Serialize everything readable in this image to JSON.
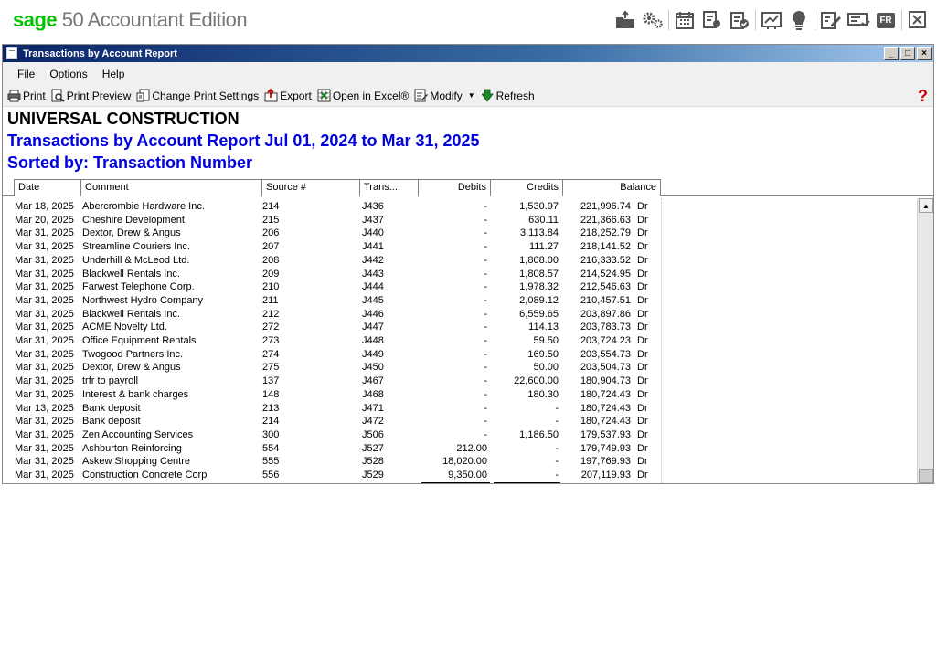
{
  "brand": {
    "sage": "sage",
    "rest": " 50 Accountant Edition"
  },
  "app_tools": [
    "folder-arrow-icon",
    "gears-icon",
    "calendar-icon",
    "gear-document-icon",
    "clipboard-check-icon",
    "chart-icon",
    "lightbulb-icon",
    "pen-document-icon",
    "check-icon",
    "FR",
    "exit-icon"
  ],
  "window": {
    "title": "Transactions by Account Report",
    "minimize": "_",
    "maximize": "□",
    "close": "×"
  },
  "menu": [
    "File",
    "Options",
    "Help"
  ],
  "toolbar": {
    "print": "Print",
    "print_preview": "Print Preview",
    "change_print_settings": "Change Print Settings",
    "export": "Export",
    "open_in_excel": "Open in Excel®",
    "modify": "Modify",
    "refresh": "Refresh",
    "help": "?"
  },
  "report": {
    "company": "UNIVERSAL CONSTRUCTION",
    "title": "Transactions by Account Report Jul 01, 2024 to Mar 31, 2025",
    "sorted_by": "Sorted by: Transaction Number"
  },
  "columns": [
    "Date",
    "Comment",
    "Source #",
    "Trans....",
    "Debits",
    "Credits",
    "Balance"
  ],
  "rows": [
    {
      "date": "Mar 18, 2025",
      "comment": "Abercrombie Hardware Inc.",
      "source": "214",
      "trans": "J436",
      "debits": "-",
      "credits": "1,530.97",
      "balance": "221,996.74",
      "drcr": "Dr"
    },
    {
      "date": "Mar 20, 2025",
      "comment": "Cheshire Development",
      "source": "215",
      "trans": "J437",
      "debits": "-",
      "credits": "630.11",
      "balance": "221,366.63",
      "drcr": "Dr"
    },
    {
      "date": "Mar 31, 2025",
      "comment": "Dextor, Drew & Angus",
      "source": "206",
      "trans": "J440",
      "debits": "-",
      "credits": "3,113.84",
      "balance": "218,252.79",
      "drcr": "Dr"
    },
    {
      "date": "Mar 31, 2025",
      "comment": "Streamline Couriers Inc.",
      "source": "207",
      "trans": "J441",
      "debits": "-",
      "credits": "111.27",
      "balance": "218,141.52",
      "drcr": "Dr"
    },
    {
      "date": "Mar 31, 2025",
      "comment": "Underhill & McLeod Ltd.",
      "source": "208",
      "trans": "J442",
      "debits": "-",
      "credits": "1,808.00",
      "balance": "216,333.52",
      "drcr": "Dr"
    },
    {
      "date": "Mar 31, 2025",
      "comment": "Blackwell Rentals Inc.",
      "source": "209",
      "trans": "J443",
      "debits": "-",
      "credits": "1,808.57",
      "balance": "214,524.95",
      "drcr": "Dr"
    },
    {
      "date": "Mar 31, 2025",
      "comment": "Farwest Telephone Corp.",
      "source": "210",
      "trans": "J444",
      "debits": "-",
      "credits": "1,978.32",
      "balance": "212,546.63",
      "drcr": "Dr"
    },
    {
      "date": "Mar 31, 2025",
      "comment": "Northwest Hydro Company",
      "source": "211",
      "trans": "J445",
      "debits": "-",
      "credits": "2,089.12",
      "balance": "210,457.51",
      "drcr": "Dr"
    },
    {
      "date": "Mar 31, 2025",
      "comment": "Blackwell Rentals Inc.",
      "source": "212",
      "trans": "J446",
      "debits": "-",
      "credits": "6,559.65",
      "balance": "203,897.86",
      "drcr": "Dr"
    },
    {
      "date": "Mar 31, 2025",
      "comment": "ACME Novelty Ltd.",
      "source": "272",
      "trans": "J447",
      "debits": "-",
      "credits": "114.13",
      "balance": "203,783.73",
      "drcr": "Dr"
    },
    {
      "date": "Mar 31, 2025",
      "comment": "Office Equipment Rentals",
      "source": "273",
      "trans": "J448",
      "debits": "-",
      "credits": "59.50",
      "balance": "203,724.23",
      "drcr": "Dr"
    },
    {
      "date": "Mar 31, 2025",
      "comment": "Twogood Partners Inc.",
      "source": "274",
      "trans": "J449",
      "debits": "-",
      "credits": "169.50",
      "balance": "203,554.73",
      "drcr": "Dr"
    },
    {
      "date": "Mar 31, 2025",
      "comment": "Dextor, Drew & Angus",
      "source": "275",
      "trans": "J450",
      "debits": "-",
      "credits": "50.00",
      "balance": "203,504.73",
      "drcr": "Dr"
    },
    {
      "date": "Mar 31, 2025",
      "comment": "trfr to payroll",
      "source": "137",
      "trans": "J467",
      "debits": "-",
      "credits": "22,600.00",
      "balance": "180,904.73",
      "drcr": "Dr"
    },
    {
      "date": "Mar 31, 2025",
      "comment": "Interest & bank charges",
      "source": "148",
      "trans": "J468",
      "debits": "-",
      "credits": "180.30",
      "balance": "180,724.43",
      "drcr": "Dr"
    },
    {
      "date": "Mar 13, 2025",
      "comment": "Bank deposit",
      "source": "213",
      "trans": "J471",
      "debits": "-",
      "credits": "-",
      "balance": "180,724.43",
      "drcr": "Dr"
    },
    {
      "date": "Mar 31, 2025",
      "comment": "Bank deposit",
      "source": "214",
      "trans": "J472",
      "debits": "-",
      "credits": "-",
      "balance": "180,724.43",
      "drcr": "Dr"
    },
    {
      "date": "Mar 31, 2025",
      "comment": "Zen Accounting Services",
      "source": "300",
      "trans": "J506",
      "debits": "-",
      "credits": "1,186.50",
      "balance": "179,537.93",
      "drcr": "Dr"
    },
    {
      "date": "Mar 31, 2025",
      "comment": "Ashburton Reinforcing",
      "source": "554",
      "trans": "J527",
      "debits": "212.00",
      "credits": "-",
      "balance": "179,749.93",
      "drcr": "Dr"
    },
    {
      "date": "Mar 31, 2025",
      "comment": "Askew Shopping Centre",
      "source": "555",
      "trans": "J528",
      "debits": "18,020.00",
      "credits": "-",
      "balance": "197,769.93",
      "drcr": "Dr"
    },
    {
      "date": "Mar 31, 2025",
      "comment": "Construction Concrete Corp",
      "source": "556",
      "trans": "J529",
      "debits": "9,350.00",
      "credits": "-",
      "balance": "207,119.93",
      "drcr": "Dr"
    }
  ]
}
